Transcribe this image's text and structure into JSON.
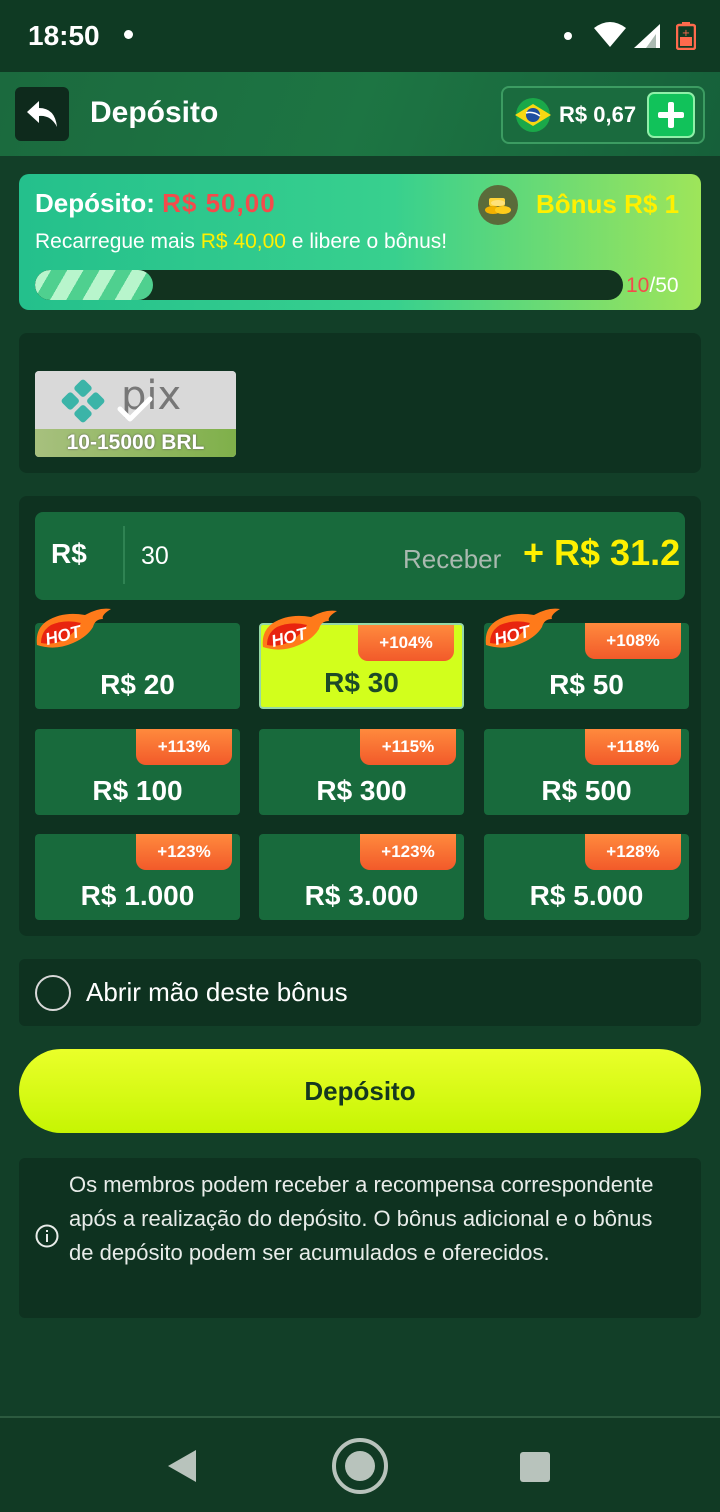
{
  "status_bar": {
    "time": "18:50"
  },
  "header": {
    "title": "Depósito",
    "balance": "R$ 0,67"
  },
  "bonus_card": {
    "deposit_label": "Depósito:",
    "deposit_amount": "R$ 50,00",
    "bonus_label": "Bônus R$ 1",
    "recharge_prefix": "Recarregue mais ",
    "recharge_amount": "R$ 40,00",
    "recharge_suffix": " e libere o bônus!",
    "progress_current": "10",
    "progress_total": "/50",
    "progress_fraction": 0.2
  },
  "payment": {
    "method_name": "pix",
    "method_range": "10-15000 BRL"
  },
  "amount_input": {
    "currency": "R$",
    "value": "30",
    "receive_label": "Receber",
    "receive_value": "+ R$ 31.2"
  },
  "amount_options": [
    {
      "label": "R$ 20",
      "badge": "",
      "hot": true,
      "selected": false
    },
    {
      "label": "R$ 30",
      "badge": "+104%",
      "hot": true,
      "selected": true
    },
    {
      "label": "R$ 50",
      "badge": "+108%",
      "hot": true,
      "selected": false
    },
    {
      "label": "R$ 100",
      "badge": "+113%",
      "hot": false,
      "selected": false
    },
    {
      "label": "R$ 300",
      "badge": "+115%",
      "hot": false,
      "selected": false
    },
    {
      "label": "R$ 500",
      "badge": "+118%",
      "hot": false,
      "selected": false
    },
    {
      "label": "R$ 1.000",
      "badge": "+123%",
      "hot": false,
      "selected": false
    },
    {
      "label": "R$ 3.000",
      "badge": "+123%",
      "hot": false,
      "selected": false
    },
    {
      "label": "R$ 5.000",
      "badge": "+128%",
      "hot": false,
      "selected": false
    }
  ],
  "hot_badge_text": "HOT",
  "optout": {
    "label": "Abrir mão deste bônus"
  },
  "deposit_button": {
    "label": "Depósito"
  },
  "info": {
    "text": "Os membros podem receber a recompensa correspondente após a realização do depósito. O bônus adicional e o bônus de depósito podem ser acumulados e oferecidos."
  },
  "colors": {
    "background": "#123f28",
    "accent_yellow": "#fff000",
    "accent_red": "#f44b4b",
    "button_lime": "#d2ff1c",
    "badge_orange": "#f25a2a"
  }
}
